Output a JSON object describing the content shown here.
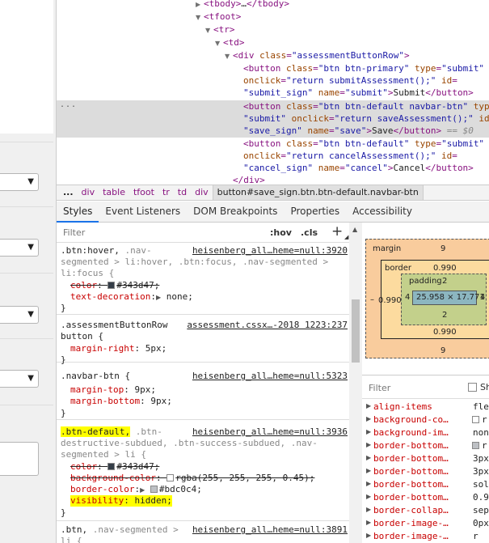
{
  "elements_tree": {
    "lines": [
      {
        "tri": "▶",
        "open": "<tbody>",
        "mid": "…",
        "close": "</tbody>"
      },
      {
        "tri": "▼",
        "open": "<tfoot>"
      },
      {
        "tri": "▼",
        "open": "<tr>"
      },
      {
        "tri": "▼",
        "open": "<td>"
      },
      {
        "tri": "▼",
        "tag": "<div ",
        "attr": "class",
        "eq": "=",
        "val": "\"assessmentButtonRow\"",
        "end": ">"
      }
    ],
    "btn1": {
      "l1_tag": "<button ",
      "a_class": "class",
      "v_class": "\"btn btn-primary\"",
      "a_type": " type",
      "v_type": "\"submit\"",
      "a_onclick": "onclick",
      "v_onclick": "\"return submitAssessment();\"",
      "a_id": " id",
      "v_id": "\"submit_sign\"",
      "a_name": " name",
      "v_name": "\"submit\"",
      "text": "Submit",
      "close": "</button>"
    },
    "ellipsis": "...",
    "btn2": {
      "tag": "<button ",
      "a_class": "class",
      "v_class": "\"btn btn-default navbar-btn\"",
      "a_type": " typ",
      "v_type": "\"submit\"",
      "a_onclick": " onclick",
      "v_onclick": "\"return saveAssessment();\"",
      "a_id": " id",
      "v_id": "\"save_sign\"",
      "a_name": " name",
      "v_name": "\"save\"",
      "text": "Save",
      "close": "</button>",
      "eq0": " == $0"
    },
    "btn3": {
      "tag": "<button ",
      "a_class": "class",
      "v_class": "\"btn btn-default\"",
      "a_type": " type",
      "v_type": "\"submit\"",
      "a_onclick": "onclick",
      "v_onclick": "\"return cancelAssessment();\"",
      "a_id": " id",
      "v_id": "\"cancel_sign\"",
      "a_name": " name",
      "v_name": "\"cancel\"",
      "text": "Cancel",
      "close": "</button>"
    },
    "div_close": "</div>"
  },
  "breadcrumbs": {
    "ellipsis": "...",
    "items": [
      "div",
      "table",
      "tfoot",
      "tr",
      "td",
      "div"
    ],
    "current": "button#save_sign.btn.btn-default.navbar-btn"
  },
  "tabs": [
    "Styles",
    "Event Listeners",
    "DOM Breakpoints",
    "Properties",
    "Accessibility"
  ],
  "styles_filter": {
    "placeholder": "Filter",
    "hov": ":hov",
    "cls": ".cls",
    "plus": "+"
  },
  "rules": [
    {
      "sel1": ".btn:hover, ",
      "sel1b": ".nav-",
      "src": "heisenberg_all…heme=null:3920",
      "sel2": "segmented > li:hover, .btn:focus, .nav-segmented >",
      "sel3": "li:focus {",
      "p1n": "color",
      "p1v": "#343d47;",
      "p1c": "#343d47",
      "p2n": "text-decoration",
      "p2v": "none;",
      "close": "}"
    },
    {
      "sel": ".assessmentButtonRow",
      "src": "assessment.cssx…-2018 1223:237",
      "sel2": "button {",
      "p1n": "margin-right",
      "p1v": "5px;",
      "close": "}"
    },
    {
      "sel": ".navbar-btn {",
      "src": "heisenberg_all…heme=null:5323",
      "p1n": "margin-top",
      "p1v": "9px;",
      "p2n": "margin-bottom",
      "p2v": "9px;",
      "close": "}"
    },
    {
      "selhl": ".btn-default,",
      "sel1b": " .btn-",
      "src": "heisenberg_all…heme=null:3936",
      "sel2": "destructive-subdued, .btn-success-subdued, .nav-",
      "sel3": "segmented > li {",
      "p1n": "color",
      "p1v": "#343d47;",
      "p1c": "#343d47",
      "p2n": "background-color",
      "p2v": "rgba(255, 255, 255, 0.45);",
      "p2c": "#ffffff",
      "p3n": "border-color",
      "p3v": "#bdc0c4;",
      "p3c": "#bdc0c4",
      "p4n": "visibility",
      "p4v": "hidden;",
      "close": "}"
    },
    {
      "sel1": ".btn, ",
      "sel1b": ".nav-segmented >",
      "src": "heisenberg_all…heme=null:3891",
      "sel2": "li {"
    }
  ],
  "box_model": {
    "margin_label": "margin",
    "margin_top": "9",
    "margin_bottom": "9",
    "margin_left": "–",
    "margin_right": "",
    "border_label": "border",
    "border_top": "0.990",
    "border_bottom": "0.990",
    "border_left": "0.990",
    "border_right": "",
    "padding_label": "padding",
    "padding_top": "2",
    "padding_bottom": "2",
    "padding_left": "4",
    "padding_right": "4",
    "content": "25.958 × 17.771"
  },
  "computed": {
    "placeholder": "Filter",
    "show_all": "Sh",
    "props": [
      {
        "name": "align-items",
        "value": "fle"
      },
      {
        "name": "background-co…",
        "value": "r",
        "swatch": "#ffffff"
      },
      {
        "name": "background-im…",
        "value": "non"
      },
      {
        "name": "border-bottom…",
        "value": "r",
        "swatch": "#bdc0c4"
      },
      {
        "name": "border-bottom…",
        "value": "3px"
      },
      {
        "name": "border-bottom…",
        "value": "3px"
      },
      {
        "name": "border-bottom…",
        "value": "sol"
      },
      {
        "name": "border-bottom…",
        "value": "0.9"
      },
      {
        "name": "border-collap…",
        "value": "sep"
      },
      {
        "name": "border-image-…",
        "value": "0px"
      },
      {
        "name": "border-image-…",
        "value": "r"
      }
    ]
  }
}
